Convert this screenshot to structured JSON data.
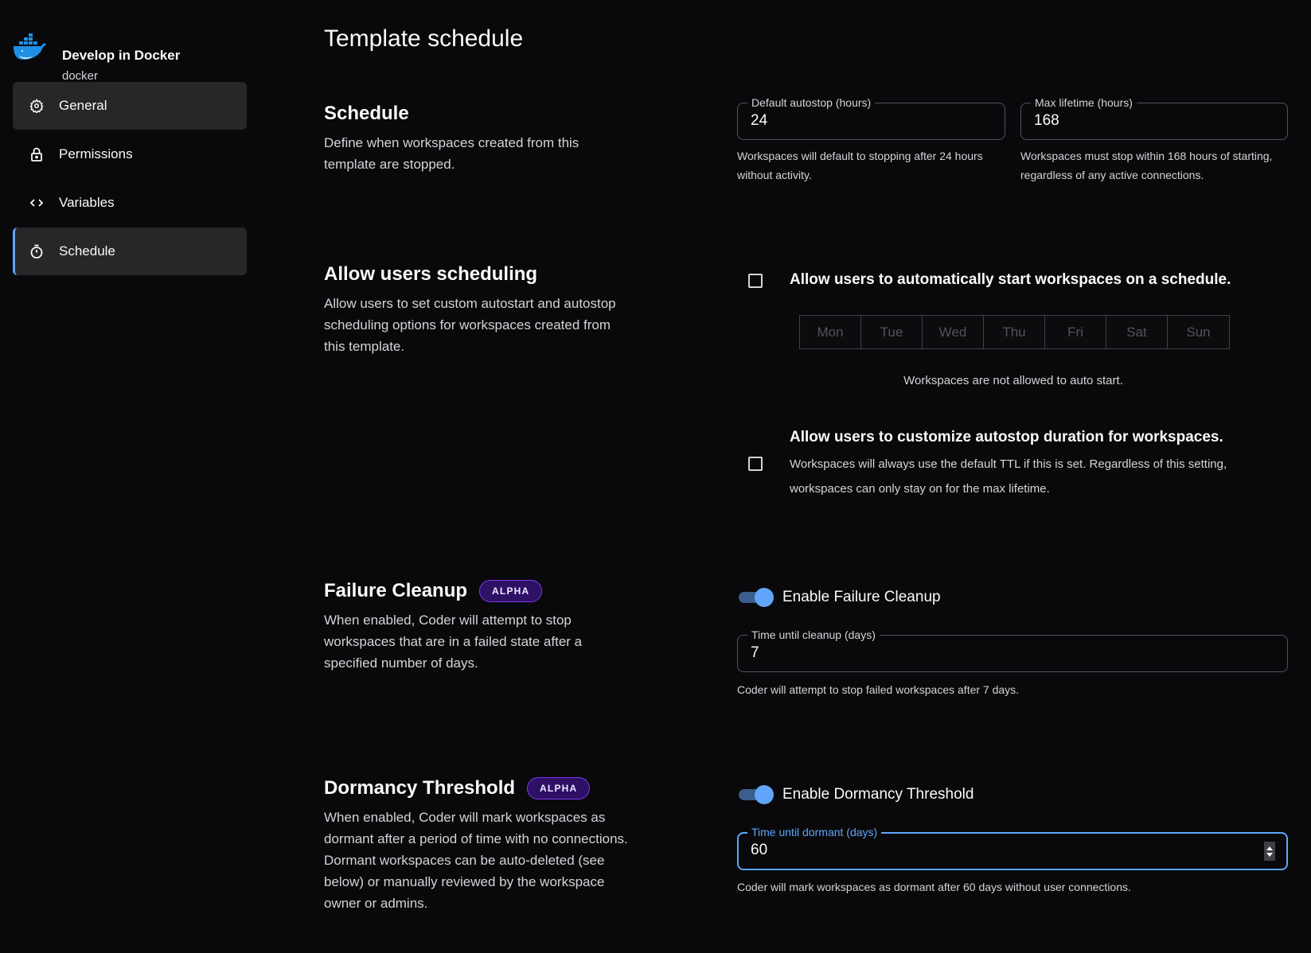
{
  "template": {
    "name": "Develop in Docker",
    "slug": "docker",
    "logo_icon": "docker-whale-icon"
  },
  "sidebar": {
    "items": [
      {
        "label": "General",
        "icon": "gear-icon",
        "state": "hover"
      },
      {
        "label": "Permissions",
        "icon": "lock-icon",
        "state": "normal"
      },
      {
        "label": "Variables",
        "icon": "code-icon",
        "state": "normal"
      },
      {
        "label": "Schedule",
        "icon": "timer-icon",
        "state": "selected"
      }
    ]
  },
  "page": {
    "title": "Template schedule"
  },
  "schedule": {
    "title": "Schedule",
    "description": "Define when workspaces created from this template are stopped.",
    "default_autostop": {
      "label": "Default autostop (hours)",
      "value": "24",
      "helper": "Workspaces will default to stopping after 24 hours without activity."
    },
    "max_lifetime": {
      "label": "Max lifetime (hours)",
      "value": "168",
      "helper": "Workspaces must stop within 168 hours of starting, regardless of any active connections."
    }
  },
  "allow_scheduling": {
    "title": "Allow users scheduling",
    "description": "Allow users to set custom autostart and autostop scheduling options for workspaces created from this template.",
    "autostart": {
      "label": "Allow users to automatically start workspaces on a schedule.",
      "checked": false,
      "days": [
        "Mon",
        "Tue",
        "Wed",
        "Thu",
        "Fri",
        "Sat",
        "Sun"
      ],
      "status": "Workspaces are not allowed to auto start."
    },
    "autostop": {
      "label": "Allow users to customize autostop duration for workspaces.",
      "checked": false,
      "description": "Workspaces will always use the default TTL if this is set. Regardless of this setting, workspaces can only stay on for the max lifetime."
    }
  },
  "failure_cleanup": {
    "title": "Failure Cleanup",
    "badge": "ALPHA",
    "description": "When enabled, Coder will attempt to stop workspaces that are in a failed state after a specified number of days.",
    "toggle_label": "Enable Failure Cleanup",
    "enabled": true,
    "field": {
      "label": "Time until cleanup (days)",
      "value": "7",
      "helper": "Coder will attempt to stop failed workspaces after 7 days."
    }
  },
  "dormancy": {
    "title": "Dormancy Threshold",
    "badge": "ALPHA",
    "description": "When enabled, Coder will mark workspaces as dormant after a period of time with no connections. Dormant workspaces can be auto-deleted (see below) or manually reviewed by the workspace owner or admins.",
    "toggle_label": "Enable Dormancy Threshold",
    "enabled": true,
    "field": {
      "label": "Time until dormant (days)",
      "value": "60",
      "helper": "Coder will mark workspaces as dormant after 60 days without user connections."
    }
  },
  "colors": {
    "background": "#09090b",
    "accent": "#60a5fa",
    "badge_bg": "#2e1065",
    "badge_border": "#7c3aed",
    "nav_active": "#27272a"
  }
}
